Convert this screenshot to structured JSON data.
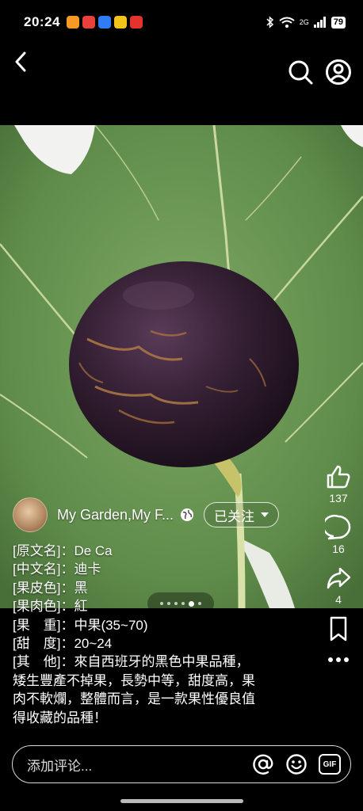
{
  "status_bar": {
    "time": "20:24",
    "signal_label": "2G",
    "battery": "79",
    "app_icons": [
      {
        "name": "app-icon-orange",
        "color": "#f59a23"
      },
      {
        "name": "app-icon-red",
        "color": "#e8403a"
      },
      {
        "name": "app-icon-blue",
        "color": "#2e7cf6"
      },
      {
        "name": "app-icon-yellow",
        "color": "#f2c318"
      },
      {
        "name": "app-icon-red2",
        "color": "#e5322d"
      }
    ]
  },
  "post": {
    "author": "My Garden,My F...",
    "follow_label": "已关注",
    "likes": "137",
    "comments": "16",
    "shares": "4",
    "description_lines": [
      "[原文名]：De Ca",
      "[中文名]：迪卡",
      "[果皮色]：黑",
      "[果肉色]：紅",
      "[果　重]：中果(35~70)",
      "[甜　度]：20~24",
      "[其　他]：來自西班牙的黑色中果品種，",
      "矮生豐產不掉果，長勢中等，甜度高，果",
      "肉不軟爛，整體而言，是一款果性優良值",
      "得收藏的品種！"
    ]
  },
  "comment_bar": {
    "placeholder": "添加评论...",
    "gif_label": "GIF"
  },
  "colors": {
    "background": "#000000",
    "leaf": "#6e9a55",
    "fig": "#3a2438"
  }
}
